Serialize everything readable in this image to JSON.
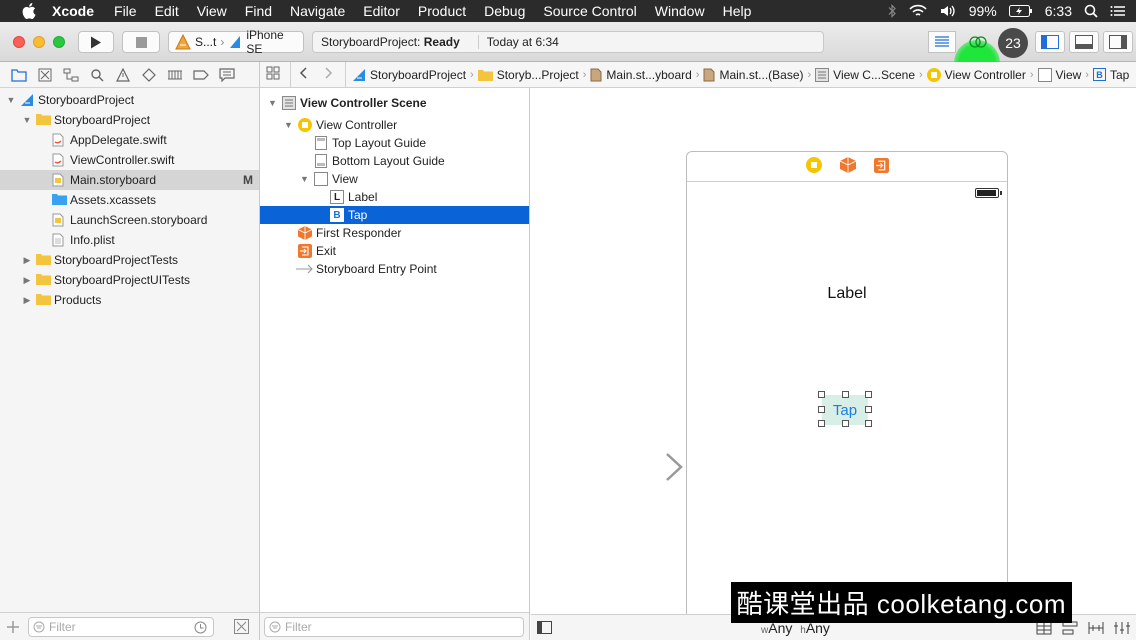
{
  "menubar": {
    "app_name": "Xcode",
    "items": [
      "File",
      "Edit",
      "View",
      "Find",
      "Navigate",
      "Editor",
      "Product",
      "Debug",
      "Source Control",
      "Window",
      "Help"
    ],
    "battery_percent": "99%",
    "clock": "6:33"
  },
  "toolbar": {
    "scheme_name": "S...t",
    "device_name": "iPhone SE",
    "activity_status_prefix": "StoryboardProject:",
    "activity_status": "Ready",
    "activity_time": "Today at 6:34",
    "badge_count": "23"
  },
  "navigator": {
    "items": [
      {
        "label": "StoryboardProject",
        "icon": "project-icon",
        "disclosure": "open",
        "modified": ""
      },
      {
        "label": "StoryboardProject",
        "icon": "folder-icon",
        "disclosure": "open",
        "modified": ""
      },
      {
        "label": "AppDelegate.swift",
        "icon": "swift-file-icon",
        "disclosure": "",
        "modified": ""
      },
      {
        "label": "ViewController.swift",
        "icon": "swift-file-icon",
        "disclosure": "",
        "modified": ""
      },
      {
        "label": "Main.storyboard",
        "icon": "storyboard-file-icon",
        "disclosure": "",
        "modified": "M"
      },
      {
        "label": "Assets.xcassets",
        "icon": "assets-folder-icon",
        "disclosure": "",
        "modified": ""
      },
      {
        "label": "LaunchScreen.storyboard",
        "icon": "storyboard-file-icon",
        "disclosure": "",
        "modified": ""
      },
      {
        "label": "Info.plist",
        "icon": "plist-file-icon",
        "disclosure": "",
        "modified": ""
      },
      {
        "label": "StoryboardProjectTests",
        "icon": "folder-icon",
        "disclosure": "closed",
        "modified": ""
      },
      {
        "label": "StoryboardProjectUITests",
        "icon": "folder-icon",
        "disclosure": "closed",
        "modified": ""
      },
      {
        "label": "Products",
        "icon": "folder-icon",
        "disclosure": "closed",
        "modified": ""
      }
    ],
    "filter_placeholder": "Filter"
  },
  "jumpbar": {
    "crumbs": [
      "StoryboardProject",
      "Storyb...Project",
      "Main.st...yboard",
      "Main.st...(Base)",
      "View C...Scene",
      "View Controller",
      "View",
      "Tap"
    ]
  },
  "outline": {
    "items": [
      {
        "label": "View Controller Scene",
        "icon": "scene-icon",
        "bold": true
      },
      {
        "label": "View Controller",
        "icon": "view-controller-icon",
        "bold": false
      },
      {
        "label": "Top Layout Guide",
        "icon": "layout-guide-icon",
        "bold": false
      },
      {
        "label": "Bottom Layout Guide",
        "icon": "layout-guide-icon",
        "bold": false
      },
      {
        "label": "View",
        "icon": "view-icon",
        "bold": false
      },
      {
        "label": "Label",
        "icon": "label-icon",
        "glyph": "L",
        "bold": false
      },
      {
        "label": "Tap",
        "icon": "button-icon",
        "glyph": "B",
        "bold": false
      },
      {
        "label": "First Responder",
        "icon": "first-responder-icon",
        "bold": false
      },
      {
        "label": "Exit",
        "icon": "exit-icon",
        "bold": false
      },
      {
        "label": "Storyboard Entry Point",
        "icon": "entry-point-arrow-icon",
        "bold": false
      }
    ],
    "filter_placeholder": "Filter"
  },
  "canvas": {
    "label_text": "Label",
    "button_text": "Tap",
    "size_class_w_prefix": "w",
    "size_class_w": "Any",
    "size_class_h_prefix": "h",
    "size_class_h": "Any"
  },
  "watermark": "酷课堂出品 coolketang.com",
  "colors": {
    "selection_blue": "#0b64d7",
    "vc_yellow": "#f7c400",
    "exit_orange": "#f0782e",
    "highlight_green": "#14e632"
  }
}
